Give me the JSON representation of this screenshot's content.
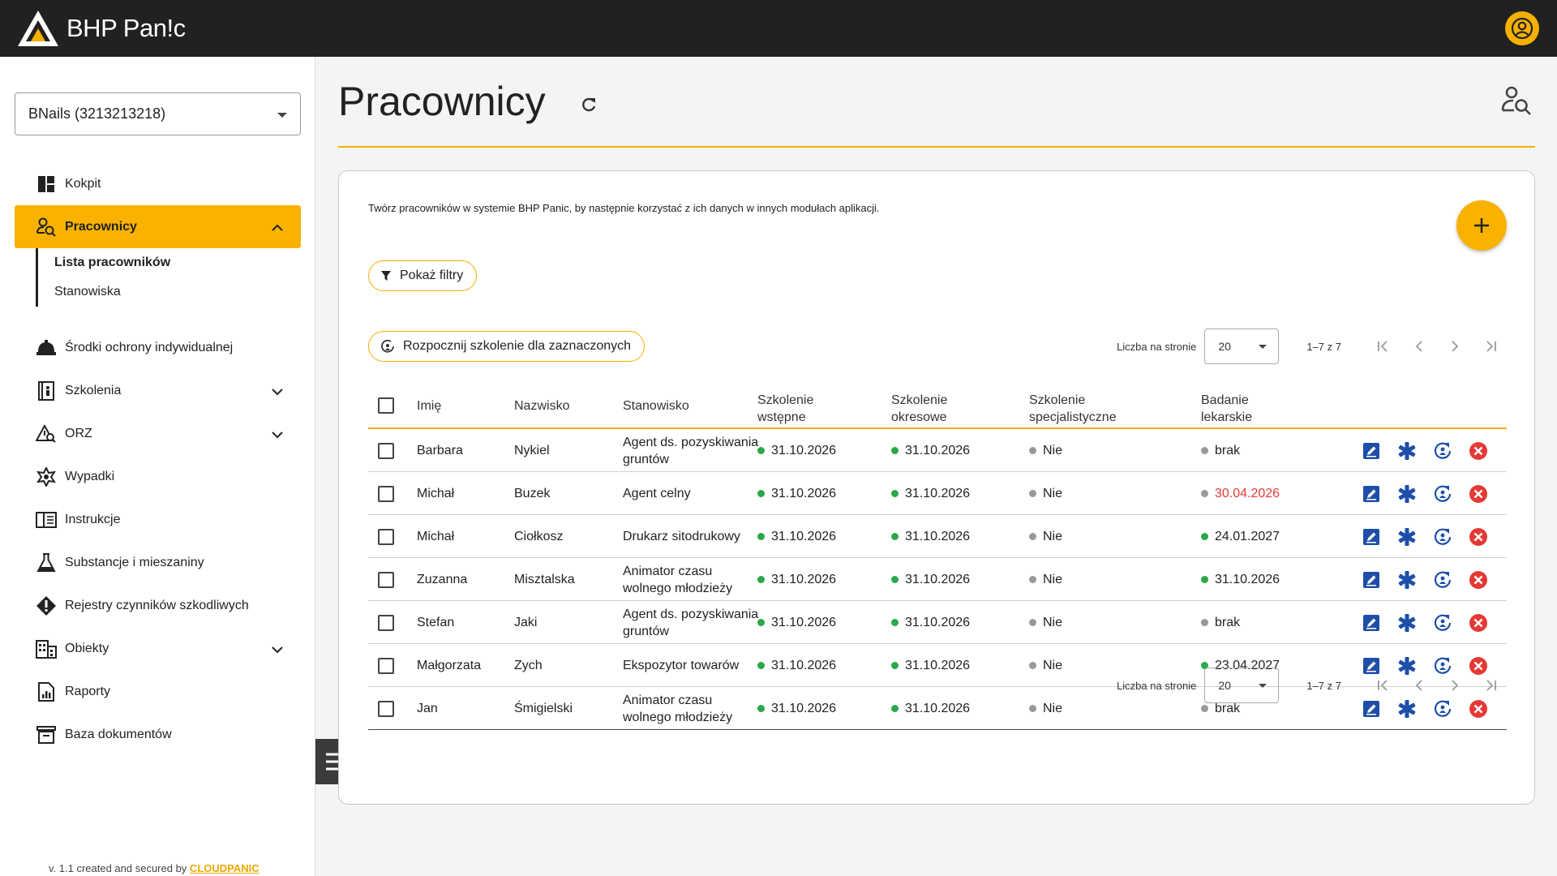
{
  "app": {
    "name": "BHP Pan!c"
  },
  "company_select": {
    "value": "BNails (3213213218)"
  },
  "nav": {
    "kokpit": "Kokpit",
    "pracownicy": "Pracownicy",
    "lista": "Lista pracowników",
    "stanowiska": "Stanowiska",
    "soi": "Środki ochrony indywidualnej",
    "szkolenia": "Szkolenia",
    "orz": "ORZ",
    "wypadki": "Wypadki",
    "instrukcje": "Instrukcje",
    "substancje": "Substancje i mieszaniny",
    "rejestry": "Rejestry czynników szkodliwych",
    "obiekty": "Obiekty",
    "raporty": "Raporty",
    "baza": "Baza dokumentów"
  },
  "footer": {
    "version": "v. 1.1 created and secured by ",
    "brand": "CLOUDPANIC"
  },
  "page": {
    "title": "Pracownicy",
    "description": "Twórz pracowników w systemie BHP Panic, by następnie korzystać z ich danych w innych modułach aplikacji."
  },
  "buttons": {
    "filters": "Pokaż filtry",
    "start_training": "Rozpocznij szkolenie dla zaznaczonych"
  },
  "pager": {
    "label": "Liczba na stronie",
    "size": "20",
    "range": "1–7 z 7"
  },
  "table": {
    "headers": {
      "imie": "Imię",
      "nazwisko": "Nazwisko",
      "stanowisko": "Stanowisko",
      "sw1": "Szkolenie",
      "sw2": "wstępne",
      "so1": "Szkolenie",
      "so2": "okresowe",
      "ss1": "Szkolenie",
      "ss2": "specjalistyczne",
      "bl1": "Badanie",
      "bl2": "lekarskie"
    },
    "rows": [
      {
        "imie": "Barbara",
        "nazwisko": "Nykiel",
        "stan1": "Agent ds. pozyskiwania",
        "stan2": "gruntów",
        "sw": "31.10.2026",
        "so": "31.10.2026",
        "ss": "Nie",
        "bl": "brak",
        "bl_status": "gray"
      },
      {
        "imie": "Michał",
        "nazwisko": "Buzek",
        "stan1": "Agent celny",
        "stan2": "",
        "sw": "31.10.2026",
        "so": "31.10.2026",
        "ss": "Nie",
        "bl": "30.04.2026",
        "bl_status": "expired"
      },
      {
        "imie": "Michał",
        "nazwisko": "Ciołkosz",
        "stan1": "Drukarz sitodrukowy",
        "stan2": "",
        "sw": "31.10.2026",
        "so": "31.10.2026",
        "ss": "Nie",
        "bl": "24.01.2027",
        "bl_status": "green"
      },
      {
        "imie": "Zuzanna",
        "nazwisko": "Misztalska",
        "stan1": "Animator czasu",
        "stan2": "wolnego młodzieży",
        "sw": "31.10.2026",
        "so": "31.10.2026",
        "ss": "Nie",
        "bl": "31.10.2026",
        "bl_status": "green"
      },
      {
        "imie": "Stefan",
        "nazwisko": "Jaki",
        "stan1": "Agent ds. pozyskiwania",
        "stan2": "gruntów",
        "sw": "31.10.2026",
        "so": "31.10.2026",
        "ss": "Nie",
        "bl": "brak",
        "bl_status": "gray"
      },
      {
        "imie": "Małgorzata",
        "nazwisko": "Zych",
        "stan1": "Ekspozytor towarów",
        "stan2": "",
        "sw": "31.10.2026",
        "so": "31.10.2026",
        "ss": "Nie",
        "bl": "23.04.2027",
        "bl_status": "green"
      },
      {
        "imie": "Jan",
        "nazwisko": "Śmigielski",
        "stan1": "Animator czasu",
        "stan2": "wolnego młodzieży",
        "sw": "31.10.2026",
        "so": "31.10.2026",
        "ss": "Nie",
        "bl": "brak",
        "bl_status": "gray"
      }
    ]
  },
  "colors": {
    "accent": "#f9b200",
    "topbar": "#212121",
    "ok": "#2aa84a",
    "expired": "#e53935",
    "action_blue": "#1e4fa8",
    "delete_red": "#e53935"
  },
  "icons": [
    "logo-icon",
    "account-icon",
    "refresh-icon",
    "search-person-icon",
    "plus-icon",
    "filter-icon",
    "training-icon",
    "edit-icon",
    "medical-icon",
    "training-cycle-icon",
    "delete-icon"
  ]
}
